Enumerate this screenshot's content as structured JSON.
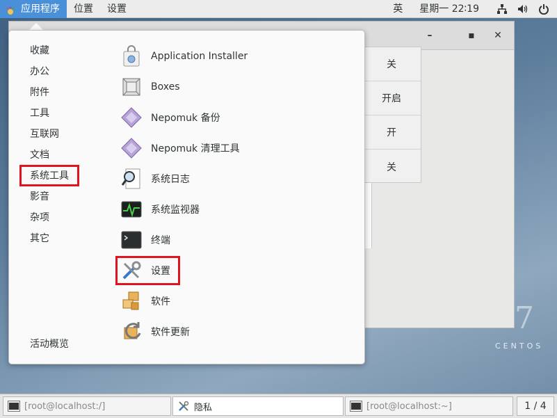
{
  "topbar": {
    "apps_label": "应用程序",
    "places_label": "位置",
    "settings_label": "设置",
    "input_method": "英",
    "clock": "星期一 22∶19"
  },
  "menu": {
    "categories": [
      "收藏",
      "办公",
      "附件",
      "工具",
      "互联网",
      "文档",
      "系统工具",
      "影音",
      "杂项",
      "其它"
    ],
    "activities_label": "活动概览",
    "apps": [
      {
        "label": "Application Installer",
        "icon": "app-installer-icon"
      },
      {
        "label": "Boxes",
        "icon": "boxes-icon"
      },
      {
        "label": "Nepomuk 备份",
        "icon": "nepomuk-icon"
      },
      {
        "label": "Nepomuk 清理工具",
        "icon": "nepomuk-icon"
      },
      {
        "label": "系统日志",
        "icon": "log-viewer-icon"
      },
      {
        "label": "系统监视器",
        "icon": "system-monitor-icon"
      },
      {
        "label": "终端",
        "icon": "terminal-icon"
      },
      {
        "label": "设置",
        "icon": "settings-tools-icon"
      },
      {
        "label": "软件",
        "icon": "software-icon"
      },
      {
        "label": "软件更新",
        "icon": "software-update-icon"
      }
    ]
  },
  "background_window": {
    "values": [
      "关",
      "开启",
      "开",
      "关"
    ]
  },
  "branding": {
    "os_name": "CENTOS",
    "version": "7"
  },
  "taskbar": {
    "tasks": [
      "[root@localhost:/]",
      "隐私",
      "[root@localhost:~]"
    ],
    "pager": "1 / 4"
  },
  "colors": {
    "highlight": "#e0141e",
    "accent": "#4a90d9"
  }
}
